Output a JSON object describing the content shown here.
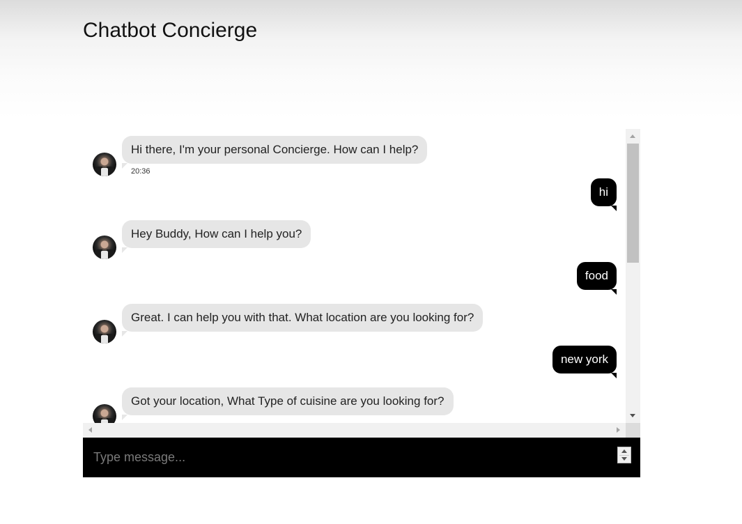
{
  "page": {
    "title": "Chatbot Concierge"
  },
  "chat": {
    "messages": [
      {
        "from": "bot",
        "text": "Hi there, I'm your personal Concierge. How can I help?",
        "time": "20:36"
      },
      {
        "from": "user",
        "text": "hi"
      },
      {
        "from": "bot",
        "text": "Hey Buddy, How can I help you?"
      },
      {
        "from": "user",
        "text": "food"
      },
      {
        "from": "bot",
        "text": "Great. I can help you with that. What location are you looking for?"
      },
      {
        "from": "user",
        "text": "new york"
      },
      {
        "from": "bot",
        "text": "Got your location, What Type of cuisine are you looking for?"
      }
    ]
  },
  "input": {
    "placeholder": "Type message...",
    "value": ""
  },
  "icons": {
    "avatar": "concierge-avatar",
    "scroll_up": "arrow-up-icon",
    "scroll_down": "arrow-down-icon",
    "spinner": "spinner-icon"
  },
  "colors": {
    "bot_bubble": "#e6e6e6",
    "user_bubble": "#000000",
    "input_bar": "#000000"
  }
}
